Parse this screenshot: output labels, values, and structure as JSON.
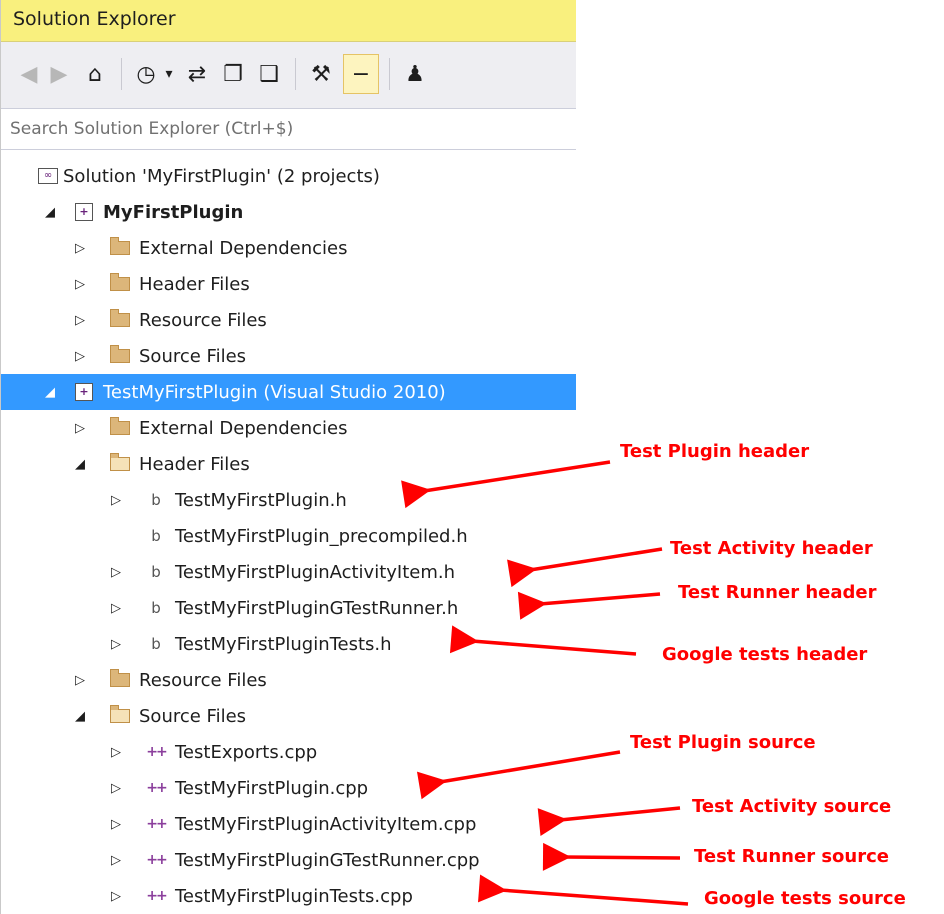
{
  "panel": {
    "title": "Solution Explorer"
  },
  "toolbar": {
    "buttons": [
      {
        "name": "back-icon",
        "glyph": "◀"
      },
      {
        "name": "forward-icon",
        "glyph": "▶"
      },
      {
        "name": "home-icon",
        "glyph": "⌂"
      },
      {
        "name": "pending-changes-filter-icon",
        "glyph": "◷"
      },
      {
        "name": "dropdown-arrow-icon",
        "glyph": "▾"
      },
      {
        "name": "sync-icon",
        "glyph": "⇄"
      },
      {
        "name": "collapse-all-icon",
        "glyph": "❐"
      },
      {
        "name": "show-all-files-icon",
        "glyph": "❑"
      },
      {
        "name": "properties-icon",
        "glyph": "⚒"
      },
      {
        "name": "preview-icon",
        "glyph": "−"
      },
      {
        "name": "team-explorer-icon",
        "glyph": "♟"
      }
    ]
  },
  "search": {
    "placeholder": "Search Solution Explorer (Ctrl+$)"
  },
  "tree": {
    "solution": "Solution 'MyFirstPlugin' (2 projects)",
    "project1": {
      "name": "MyFirstPlugin",
      "items": [
        "External Dependencies",
        "Header Files",
        "Resource Files",
        "Source Files"
      ]
    },
    "project2": {
      "name": "TestMyFirstPlugin (Visual Studio 2010)",
      "external": "External Dependencies",
      "header_folder": "Header Files",
      "headers": [
        "TestMyFirstPlugin.h",
        "TestMyFirstPlugin_precompiled.h",
        "TestMyFirstPluginActivityItem.h",
        "TestMyFirstPluginGTestRunner.h",
        "TestMyFirstPluginTests.h"
      ],
      "resource_folder": "Resource Files",
      "source_folder": "Source Files",
      "sources": [
        "TestExports.cpp",
        "TestMyFirstPlugin.cpp",
        "TestMyFirstPluginActivityItem.cpp",
        "TestMyFirstPluginGTestRunner.cpp",
        "TestMyFirstPluginTests.cpp"
      ]
    }
  },
  "annotations": [
    "Test Plugin header",
    "Test Activity header",
    "Test Runner header",
    "Google tests header",
    "Test Plugin source",
    "Test Activity source",
    "Test Runner source",
    "Google tests source"
  ],
  "colors": {
    "title_bar": "#f9f07e",
    "selection": "#3399ff",
    "annotation": "#ff0000"
  }
}
